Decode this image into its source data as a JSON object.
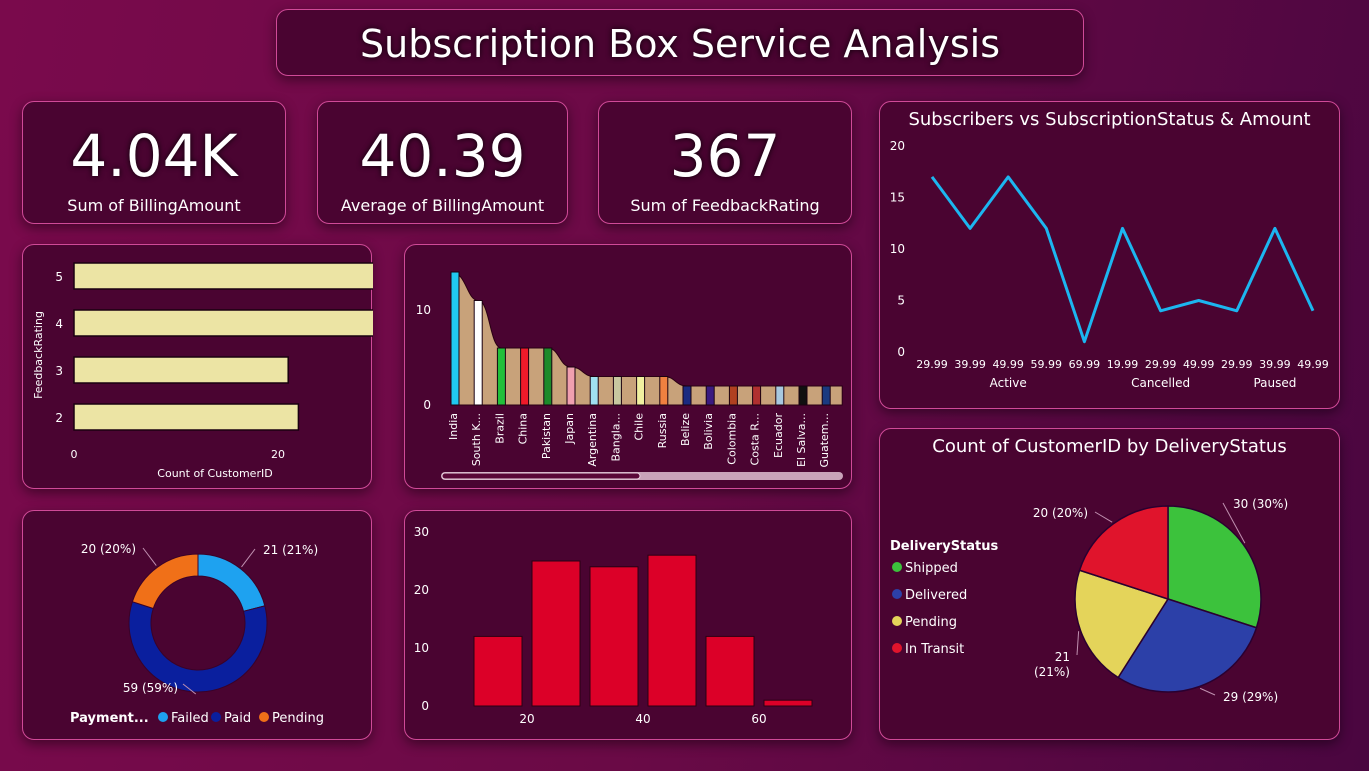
{
  "page": {
    "title": "Subscription Box Service Analysis"
  },
  "kpis": [
    {
      "value": "4.04K",
      "label": "Sum of BillingAmount"
    },
    {
      "value": "40.39",
      "label": "Average of BillingAmount"
    },
    {
      "value": "367",
      "label": "Sum of FeedbackRating"
    }
  ],
  "colors": {
    "card_bg": "#4a0431",
    "card_border": "#d04a98",
    "bar_khaki": "#ece4a4",
    "line_blue": "#1cb6f0",
    "hist_red": "#dc0028",
    "area_tan": "#c8a27a",
    "failed": "#1ea2f0",
    "paid": "#0a1f9e",
    "pending_pay": "#f07018",
    "shipped": "#3cc23c",
    "delivered": "#2c40a8",
    "pending_del": "#e4d45a",
    "in_transit": "#e0142c"
  },
  "chart_data": [
    {
      "id": "feedback",
      "type": "bar",
      "orientation": "horizontal",
      "categories": [
        "5",
        "4",
        "3",
        "2"
      ],
      "values": [
        30,
        31,
        21,
        22
      ],
      "xlabel": "Count of CustomerID",
      "ylabel": "FeedbackRating",
      "xticks": [
        "0",
        "20"
      ],
      "xlim": [
        0,
        32
      ]
    },
    {
      "id": "country",
      "type": "area",
      "categories": [
        "India",
        "South K...",
        "Brazil",
        "China",
        "Pakistan",
        "Japan",
        "Argentina",
        "Bangla...",
        "Chile",
        "Russia",
        "Belize",
        "Bolivia",
        "Colombia",
        "Costa R...",
        "Ecuador",
        "El Salva...",
        "Guatem..."
      ],
      "values": [
        14,
        11,
        6,
        6,
        6,
        4,
        3,
        3,
        3,
        3,
        2,
        2,
        2,
        2,
        2,
        2,
        2
      ],
      "yticks": [
        "0",
        "10"
      ],
      "ylim": [
        0,
        15
      ],
      "colors": [
        "#20c8f0",
        "#ffffff",
        "#22c03a",
        "#ee1a2a",
        "#1c8a2a",
        "#f0a0b0",
        "#a0e0f0",
        "#c8c8a0",
        "#f0f0a0",
        "#f08040",
        "#1a2a80",
        "#3a1a80",
        "#b04020",
        "#b03030",
        "#a8c8e0",
        "#101010",
        "#1a3a80"
      ]
    },
    {
      "id": "status_line",
      "type": "line",
      "title": "Subscribers vs SubscriptionStatus & Amount",
      "x": [
        "29.99",
        "39.99",
        "49.99",
        "59.99",
        "69.99",
        "19.99",
        "29.99",
        "49.99",
        "29.99",
        "39.99",
        "49.99"
      ],
      "groups": [
        {
          "name": "Active",
          "span": [
            0,
            4
          ]
        },
        {
          "name": "Cancelled",
          "span": [
            5,
            7
          ]
        },
        {
          "name": "Paused",
          "span": [
            8,
            10
          ]
        }
      ],
      "values": [
        17,
        12,
        17,
        12,
        1,
        12,
        4,
        5,
        4,
        12,
        4
      ],
      "yticks": [
        "0",
        "5",
        "10",
        "15",
        "20"
      ],
      "ylim": [
        0,
        20
      ]
    },
    {
      "id": "payment",
      "type": "pie",
      "legend_title": "Payment...",
      "slices": [
        {
          "name": "Failed",
          "value": 21,
          "label": "21 (21%)"
        },
        {
          "name": "Paid",
          "value": 59,
          "label": "59 (59%)"
        },
        {
          "name": "Pending",
          "value": 20,
          "label": "20 (20%)"
        }
      ]
    },
    {
      "id": "histogram",
      "type": "bar",
      "x": [
        15,
        25,
        35,
        45,
        55,
        65
      ],
      "values": [
        12,
        25,
        24,
        26,
        12,
        1
      ],
      "xticks": [
        "20",
        "40",
        "60"
      ],
      "yticks": [
        "0",
        "10",
        "20",
        "30"
      ],
      "ylim": [
        0,
        30
      ]
    },
    {
      "id": "delivery",
      "type": "pie",
      "title": "Count of CustomerID by DeliveryStatus",
      "legend_title": "DeliveryStatus",
      "slices": [
        {
          "name": "Shipped",
          "value": 30,
          "label": "30 (30%)"
        },
        {
          "name": "Delivered",
          "value": 29,
          "label": "29 (29%)"
        },
        {
          "name": "Pending",
          "value": 21,
          "label": "21\n(21%)"
        },
        {
          "name": "In Transit",
          "value": 20,
          "label": "20 (20%)"
        }
      ]
    }
  ]
}
